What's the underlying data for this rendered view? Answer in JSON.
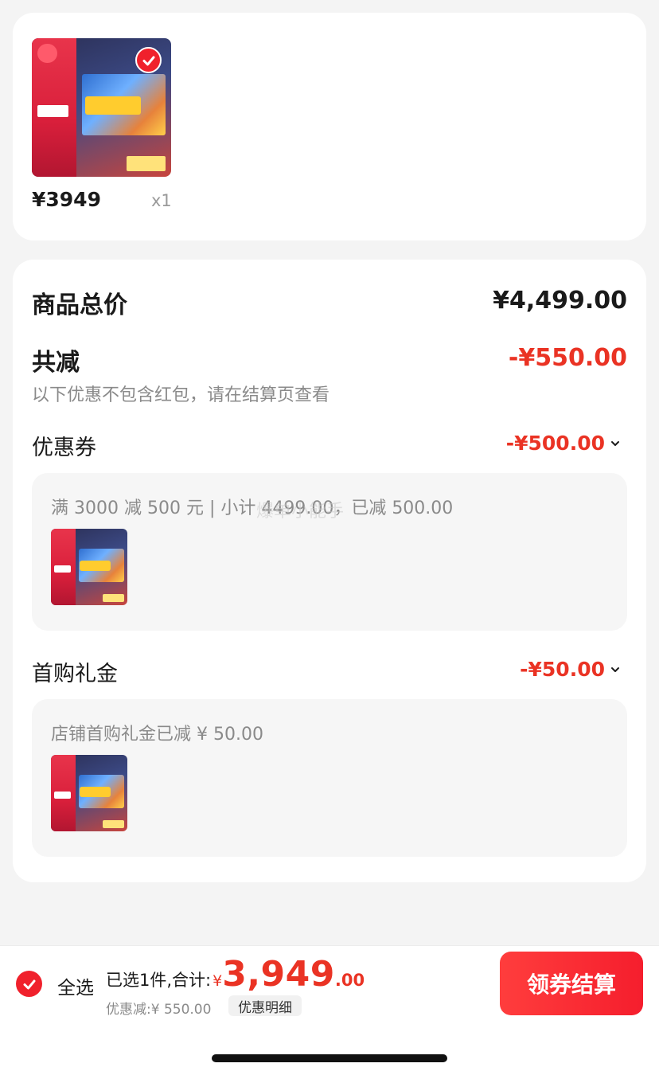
{
  "product": {
    "image_alt": "夏普电视 618 促销主图",
    "price": "¥3949",
    "quantity": "x1",
    "selected": true
  },
  "summary": {
    "subtotal_label": "商品总价",
    "subtotal_value": "¥4,499.00",
    "total_discount_label": "共减",
    "total_discount_value": "-¥550.00",
    "note": "以下优惠不包含红包，请在结算页查看",
    "coupon": {
      "label": "优惠券",
      "value": "-¥500.00",
      "detail": "满 3000 减 500 元 | 小计 4499.00，已减 500.00",
      "watermark": "爆单小能手"
    },
    "first_purchase": {
      "label": "首购礼金",
      "value": "-¥50.00",
      "detail": "店铺首购礼金已减 ¥ 50.00"
    }
  },
  "bottom_bar": {
    "select_all_label": "全选",
    "selected_text": "已选1件,合计:",
    "currency": "¥",
    "total_integer": "3,949",
    "total_decimal": ".00",
    "discount_text": "优惠减:¥ 550.00",
    "detail_label": "优惠明细",
    "checkout_label": "领券结算"
  },
  "colors": {
    "accent_red": "#ea3324",
    "button_red": "#f51e2d",
    "background": "#f4f4f4"
  }
}
